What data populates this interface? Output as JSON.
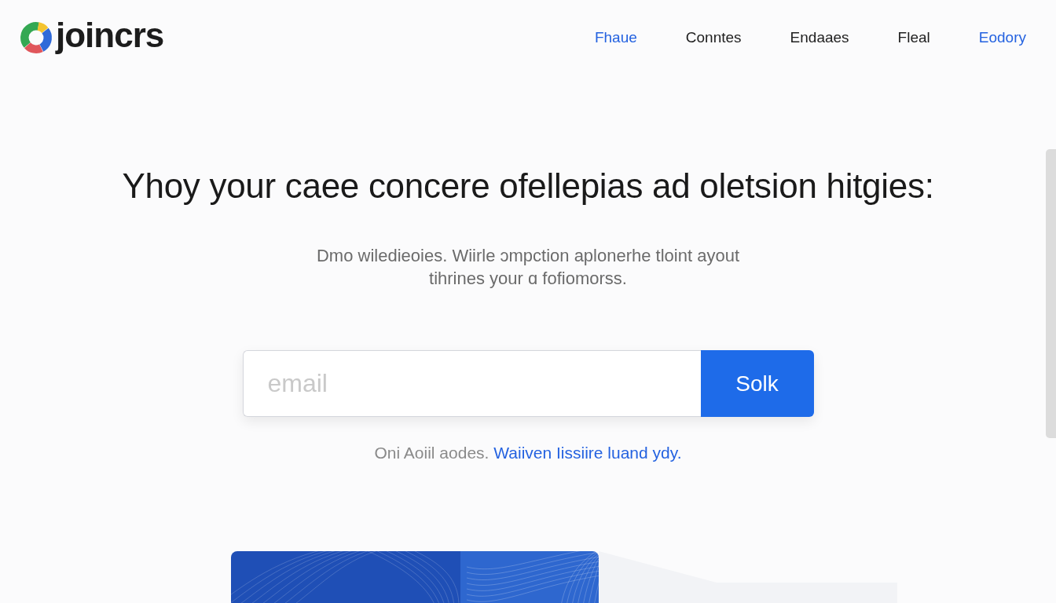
{
  "header": {
    "logo_text": "joincrs",
    "nav": [
      {
        "label": "Fhaue",
        "selected": true
      },
      {
        "label": "Conntes",
        "selected": false
      },
      {
        "label": "Endaaes",
        "selected": false
      },
      {
        "label": "Fleal",
        "selected": false
      },
      {
        "label": "Eodory",
        "selected": true
      }
    ]
  },
  "hero": {
    "title": "Yhoy your caee concere ofellepias ad oletsion hitgies:",
    "subtitle": "Dmo wiledieoies. Wiirle ɔmpction aplonerhe tloint ayout tihrines your ɑ fofiomorss."
  },
  "signup": {
    "email": {
      "placeholder": "email"
    },
    "button": "Solk"
  },
  "note": {
    "text": "Oni Aoiil aodes.",
    "link": "Waiiven Iissiire luand ydy."
  }
}
